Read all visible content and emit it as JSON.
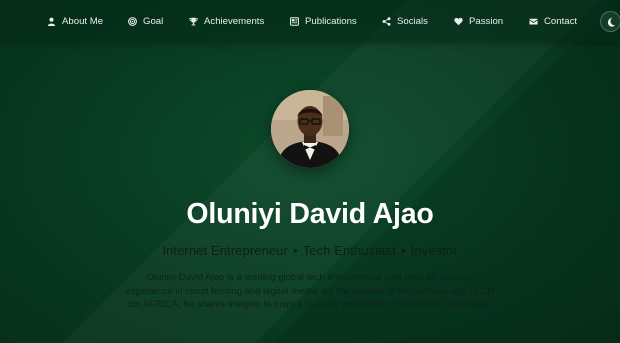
{
  "nav": {
    "items": [
      {
        "label": "About Me",
        "icon": "user-icon"
      },
      {
        "label": "Goal",
        "icon": "target-icon"
      },
      {
        "label": "Achievements",
        "icon": "trophy-icon"
      },
      {
        "label": "Publications",
        "icon": "newspaper-icon"
      },
      {
        "label": "Socials",
        "icon": "share-icon"
      },
      {
        "label": "Passion",
        "icon": "heart-icon"
      },
      {
        "label": "Contact",
        "icon": "envelope-icon"
      }
    ],
    "theme_toggle_icon": "moon-icon"
  },
  "hero": {
    "avatar_icon": "profile-photo",
    "name": "Oluniyi David Ajao",
    "tagline": {
      "roles": [
        "Internet Entrepreneur",
        "Tech Enthusiast",
        "Investor"
      ],
      "separator": "•"
    },
    "bio": "Oluniyi David Ajao is a leading global tech entrepreneur with over 20 years of experience in cloud hosting and digital media. As the founder of Web4Africa and TECH dot AFRICA, he shares insights to inspire the next generation of innovators worldwide."
  },
  "colors": {
    "background": "#0a3a22",
    "nav_text": "#e9efe9",
    "name_text": "#ffffff",
    "body_text": "#10231a"
  }
}
